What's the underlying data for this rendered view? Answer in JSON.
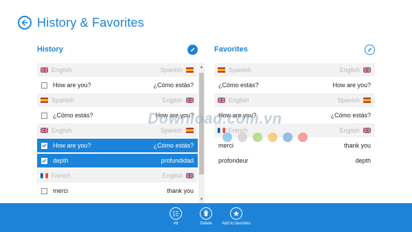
{
  "header": {
    "title": "History  & Favorites"
  },
  "history": {
    "title": "History",
    "rows": [
      {
        "kind": "lang",
        "from": "English",
        "from_flag": "uk",
        "to": "Spanish",
        "to_flag": "es"
      },
      {
        "kind": "phrase",
        "source": "How are you?",
        "translation": "¿Cómo estás?",
        "checked": false
      },
      {
        "kind": "lang",
        "from": "Spanish",
        "from_flag": "es",
        "to": "English",
        "to_flag": "uk"
      },
      {
        "kind": "phrase",
        "source": "¿Cómo estás?",
        "translation": "How are you?",
        "checked": false
      },
      {
        "kind": "lang",
        "from": "English",
        "from_flag": "uk",
        "to": "Spanish",
        "to_flag": "es"
      },
      {
        "kind": "phrase",
        "source": "How are you?",
        "translation": "¿Cómo estás?",
        "checked": true
      },
      {
        "kind": "phrase",
        "source": "depth",
        "translation": "profundidad",
        "checked": true
      },
      {
        "kind": "lang",
        "from": "French",
        "from_flag": "fr",
        "to": "English",
        "to_flag": "uk"
      },
      {
        "kind": "phrase",
        "source": "merci",
        "translation": "thank you",
        "checked": false
      }
    ]
  },
  "favorites": {
    "title": "Favorites",
    "rows": [
      {
        "kind": "lang",
        "from": "Spanish",
        "from_flag": "es",
        "to": "English",
        "to_flag": "uk"
      },
      {
        "kind": "phrase",
        "source": "¿Cómo estás?",
        "translation": "How are you?"
      },
      {
        "kind": "lang",
        "from": "English",
        "from_flag": "uk",
        "to": "Spanish",
        "to_flag": "es"
      },
      {
        "kind": "phrase",
        "source": "How are you?",
        "translation": "¿Cómo estás?"
      },
      {
        "kind": "lang",
        "from": "French",
        "from_flag": "fr",
        "to": "English",
        "to_flag": "uk"
      },
      {
        "kind": "phrase",
        "source": "merci",
        "translation": "thank you"
      },
      {
        "kind": "phrase",
        "source": "profondeur",
        "translation": "depth"
      }
    ]
  },
  "app_bar": {
    "all_label": "All",
    "delete_label": "Delete",
    "favorites_label": "Add to favorites"
  },
  "watermark": {
    "text": "Download.com.vn",
    "dot_colors": [
      "#7dc4ea",
      "#cfcfcf",
      "#a8d67a",
      "#f7c46a",
      "#7ab0e0",
      "#f08a8a"
    ]
  },
  "colors": {
    "accent": "#1c83d8",
    "lang_row_bg": "#f2f2f2",
    "lang_text": "#b9b9b9",
    "selected_row_bg": "#1c83d8"
  }
}
